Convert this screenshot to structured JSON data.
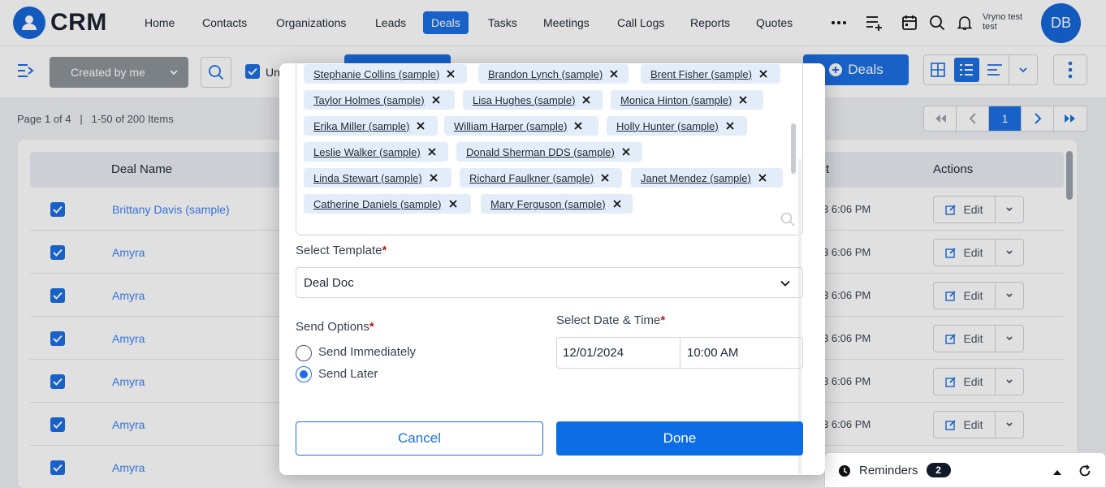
{
  "app": {
    "logo_text": "CRM"
  },
  "nav": {
    "items": [
      {
        "label": "Home"
      },
      {
        "label": "Contacts"
      },
      {
        "label": "Organizations"
      },
      {
        "label": "Leads"
      },
      {
        "label": "Deals"
      },
      {
        "label": "Tasks"
      },
      {
        "label": "Meetings"
      },
      {
        "label": "Call Logs"
      },
      {
        "label": "Reports"
      },
      {
        "label": "Quotes"
      }
    ],
    "active": "Deals",
    "user_name": "Vryno test test",
    "avatar_initials": "DB"
  },
  "toolbar": {
    "filter_label": "Created by me",
    "unchecked_label": "Un",
    "add_deals_label": "Deals"
  },
  "list": {
    "page_info": "Page 1 of 4",
    "items_info": "1-50 of 200 Items",
    "current_page": "1",
    "columns": {
      "deal_name": "Deal Name",
      "time_fragment": "t",
      "actions": "Actions"
    },
    "rows": [
      {
        "deal_name": "Brittany Davis (sample)",
        "time": "3 6:06 PM",
        "edit_label": "Edit"
      },
      {
        "deal_name": "Amyra",
        "time": "3 6:06 PM",
        "edit_label": "Edit"
      },
      {
        "deal_name": "Amyra",
        "time": "3 6:06 PM",
        "edit_label": "Edit"
      },
      {
        "deal_name": "Amyra",
        "time": "3 6:06 PM",
        "edit_label": "Edit"
      },
      {
        "deal_name": "Amyra",
        "time": "3 6:06 PM",
        "edit_label": "Edit"
      },
      {
        "deal_name": "Amyra",
        "time": "3 6:06 PM",
        "edit_label": "Edit"
      },
      {
        "deal_name": "Amyra",
        "time": "",
        "edit_label": ""
      }
    ]
  },
  "modal": {
    "recipients": [
      "Stephanie Collins (sample)",
      "Brandon Lynch (sample)",
      "Brent Fisher (sample)",
      "Taylor Holmes (sample)",
      "Lisa Hughes (sample)",
      "Monica Hinton (sample)",
      "Erika Miller (sample)",
      "William Harper (sample)",
      "Holly Hunter (sample)",
      "Leslie Walker (sample)",
      "Donald Sherman DDS (sample)",
      "Linda Stewart (sample)",
      "Richard Faulkner (sample)",
      "Janet Mendez (sample)",
      "Catherine Daniels (sample)",
      "Mary Ferguson (sample)"
    ],
    "template_label": "Select Template",
    "template_value": "Deal Doc",
    "send_options_label": "Send Options",
    "send_immediately_label": "Send Immediately",
    "send_later_label": "Send Later",
    "selected_option": "Send Later",
    "datetime_label": "Select Date & Time",
    "date_value": "12/01/2024",
    "time_value": "10:00 AM",
    "cancel_label": "Cancel",
    "done_label": "Done"
  },
  "reminders": {
    "label": "Reminders",
    "count": "2"
  },
  "colors": {
    "accent": "#1c6fe3",
    "active_nav": "#1c6fe3",
    "required": "#b91c1c"
  }
}
